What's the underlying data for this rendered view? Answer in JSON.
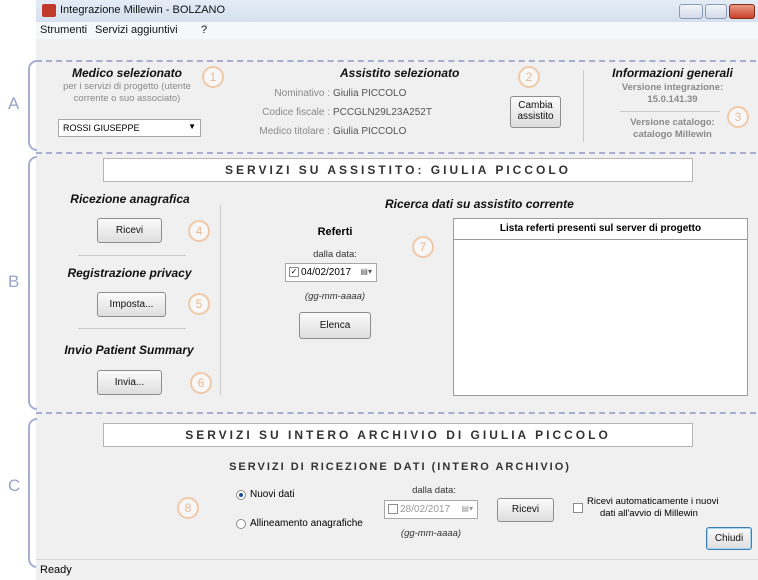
{
  "window": {
    "title": "Integrazione Millewin - BOLZANO"
  },
  "menu": [
    {
      "label": "Strumenti"
    },
    {
      "label": "Servizi aggiuntivi"
    },
    {
      "label": "?"
    }
  ],
  "sections": {
    "a": "A",
    "b": "B",
    "c": "C"
  },
  "markers": [
    "1",
    "2",
    "3",
    "4",
    "5",
    "6",
    "7",
    "8"
  ],
  "medico": {
    "title": "Medico selezionato",
    "subtitle_line1": "per i servizi di progetto (utente",
    "subtitle_line2": "corrente o suo associato)",
    "selected": "ROSSI GIUSEPPE"
  },
  "assistito": {
    "title": "Assistito selezionato",
    "nominativo_label": "Nominativo :",
    "nominativo_value": "Giulia PICCOLO",
    "cf_label": "Codice fiscale :",
    "cf_value": "PCCGLN29L23A252T",
    "medico_label": "Medico titolare :",
    "medico_value": "Giulia PICCOLO",
    "change_line1": "Cambia",
    "change_line2": "assistito"
  },
  "info": {
    "title": "Informazioni generali",
    "version_label": "Versione integrazione:",
    "version_value": "15.0.141.39",
    "catalog_label": "Versione catalogo:",
    "catalog_value": "catalogo Millewin"
  },
  "servizi_assistito": {
    "header": "SERVIZI SU ASSISTITO:  GIULIA PICCOLO",
    "ricezione_title": "Ricezione anagrafica",
    "ricevi": "Ricevi",
    "privacy_title": "Registrazione privacy",
    "imposta": "Imposta...",
    "summary_title": "Invio Patient Summary",
    "invia": "Invia...",
    "ricerca_title": "Ricerca dati su assistito corrente",
    "referti_title": "Referti",
    "dalla_data": "dalla data:",
    "date_value": "04/02/2017",
    "date_format": "(gg-mm-aaaa)",
    "elenca": "Elenca",
    "list_header": "Lista referti presenti sul server di progetto"
  },
  "servizi_archivio": {
    "header": "SERVIZI SU INTERO ARCHIVIO DI GIULIA PICCOLO",
    "subheader": "SERVIZI DI RICEZIONE DATI (INTERO ARCHIVIO)",
    "radio1": "Nuovi dati",
    "radio2": "Allineamento anagrafiche",
    "dalla_data": "dalla data:",
    "date_value": "28/02/2017",
    "date_format": "(gg-mm-aaaa)",
    "ricevi": "Ricevi",
    "auto_line1": "Ricevi automaticamente i nuovi",
    "auto_line2": "dati all'avvio di Millewin"
  },
  "close_button": "Chiudi",
  "status": "Ready",
  "colors": {
    "marker": "#e9b98f",
    "bracket": "#a8aed0",
    "section_letter": "#9aa3c4"
  }
}
